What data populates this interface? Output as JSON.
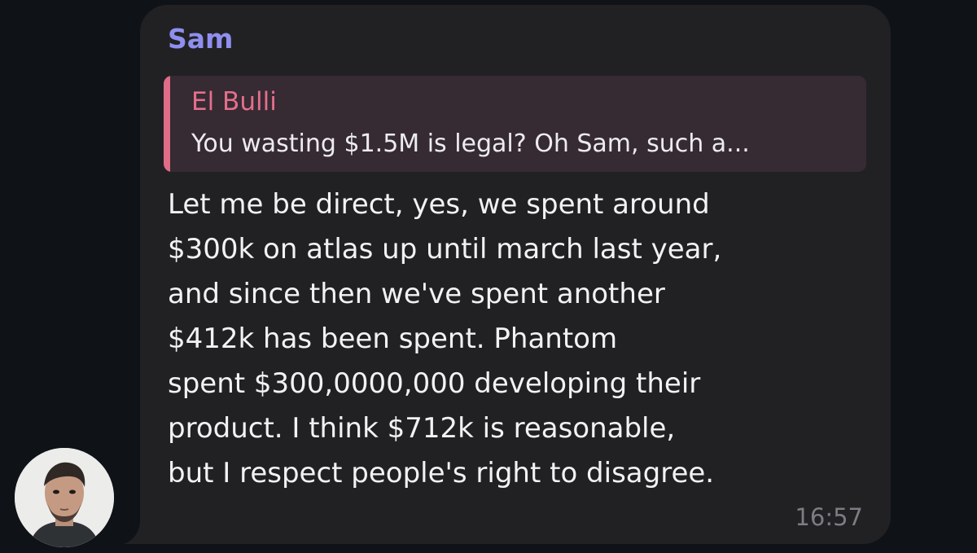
{
  "message": {
    "sender": "Sam",
    "reply": {
      "author": "El Bulli",
      "text": "You wasting $1.5M is legal? Oh Sam, such a..."
    },
    "lines": [
      "Let me be direct, yes, we spent around",
      "$300k on atlas up until march last year,",
      "and since then we've spent another",
      "$412k has been spent. Phantom",
      "spent $300,0000,000 developing their",
      "product. I think $712k is reasonable,",
      "but I respect people's right to disagree."
    ],
    "time": "16:57"
  },
  "colors": {
    "background": "#0f1318",
    "bubble": "#212124",
    "sender": "#8f8fef",
    "reply_accent": "#e06c88",
    "reply_background": "#362a33",
    "text": "#f2f2f3",
    "time": "#7c7c82"
  },
  "icons": {
    "avatar": "user-avatar-photo"
  }
}
